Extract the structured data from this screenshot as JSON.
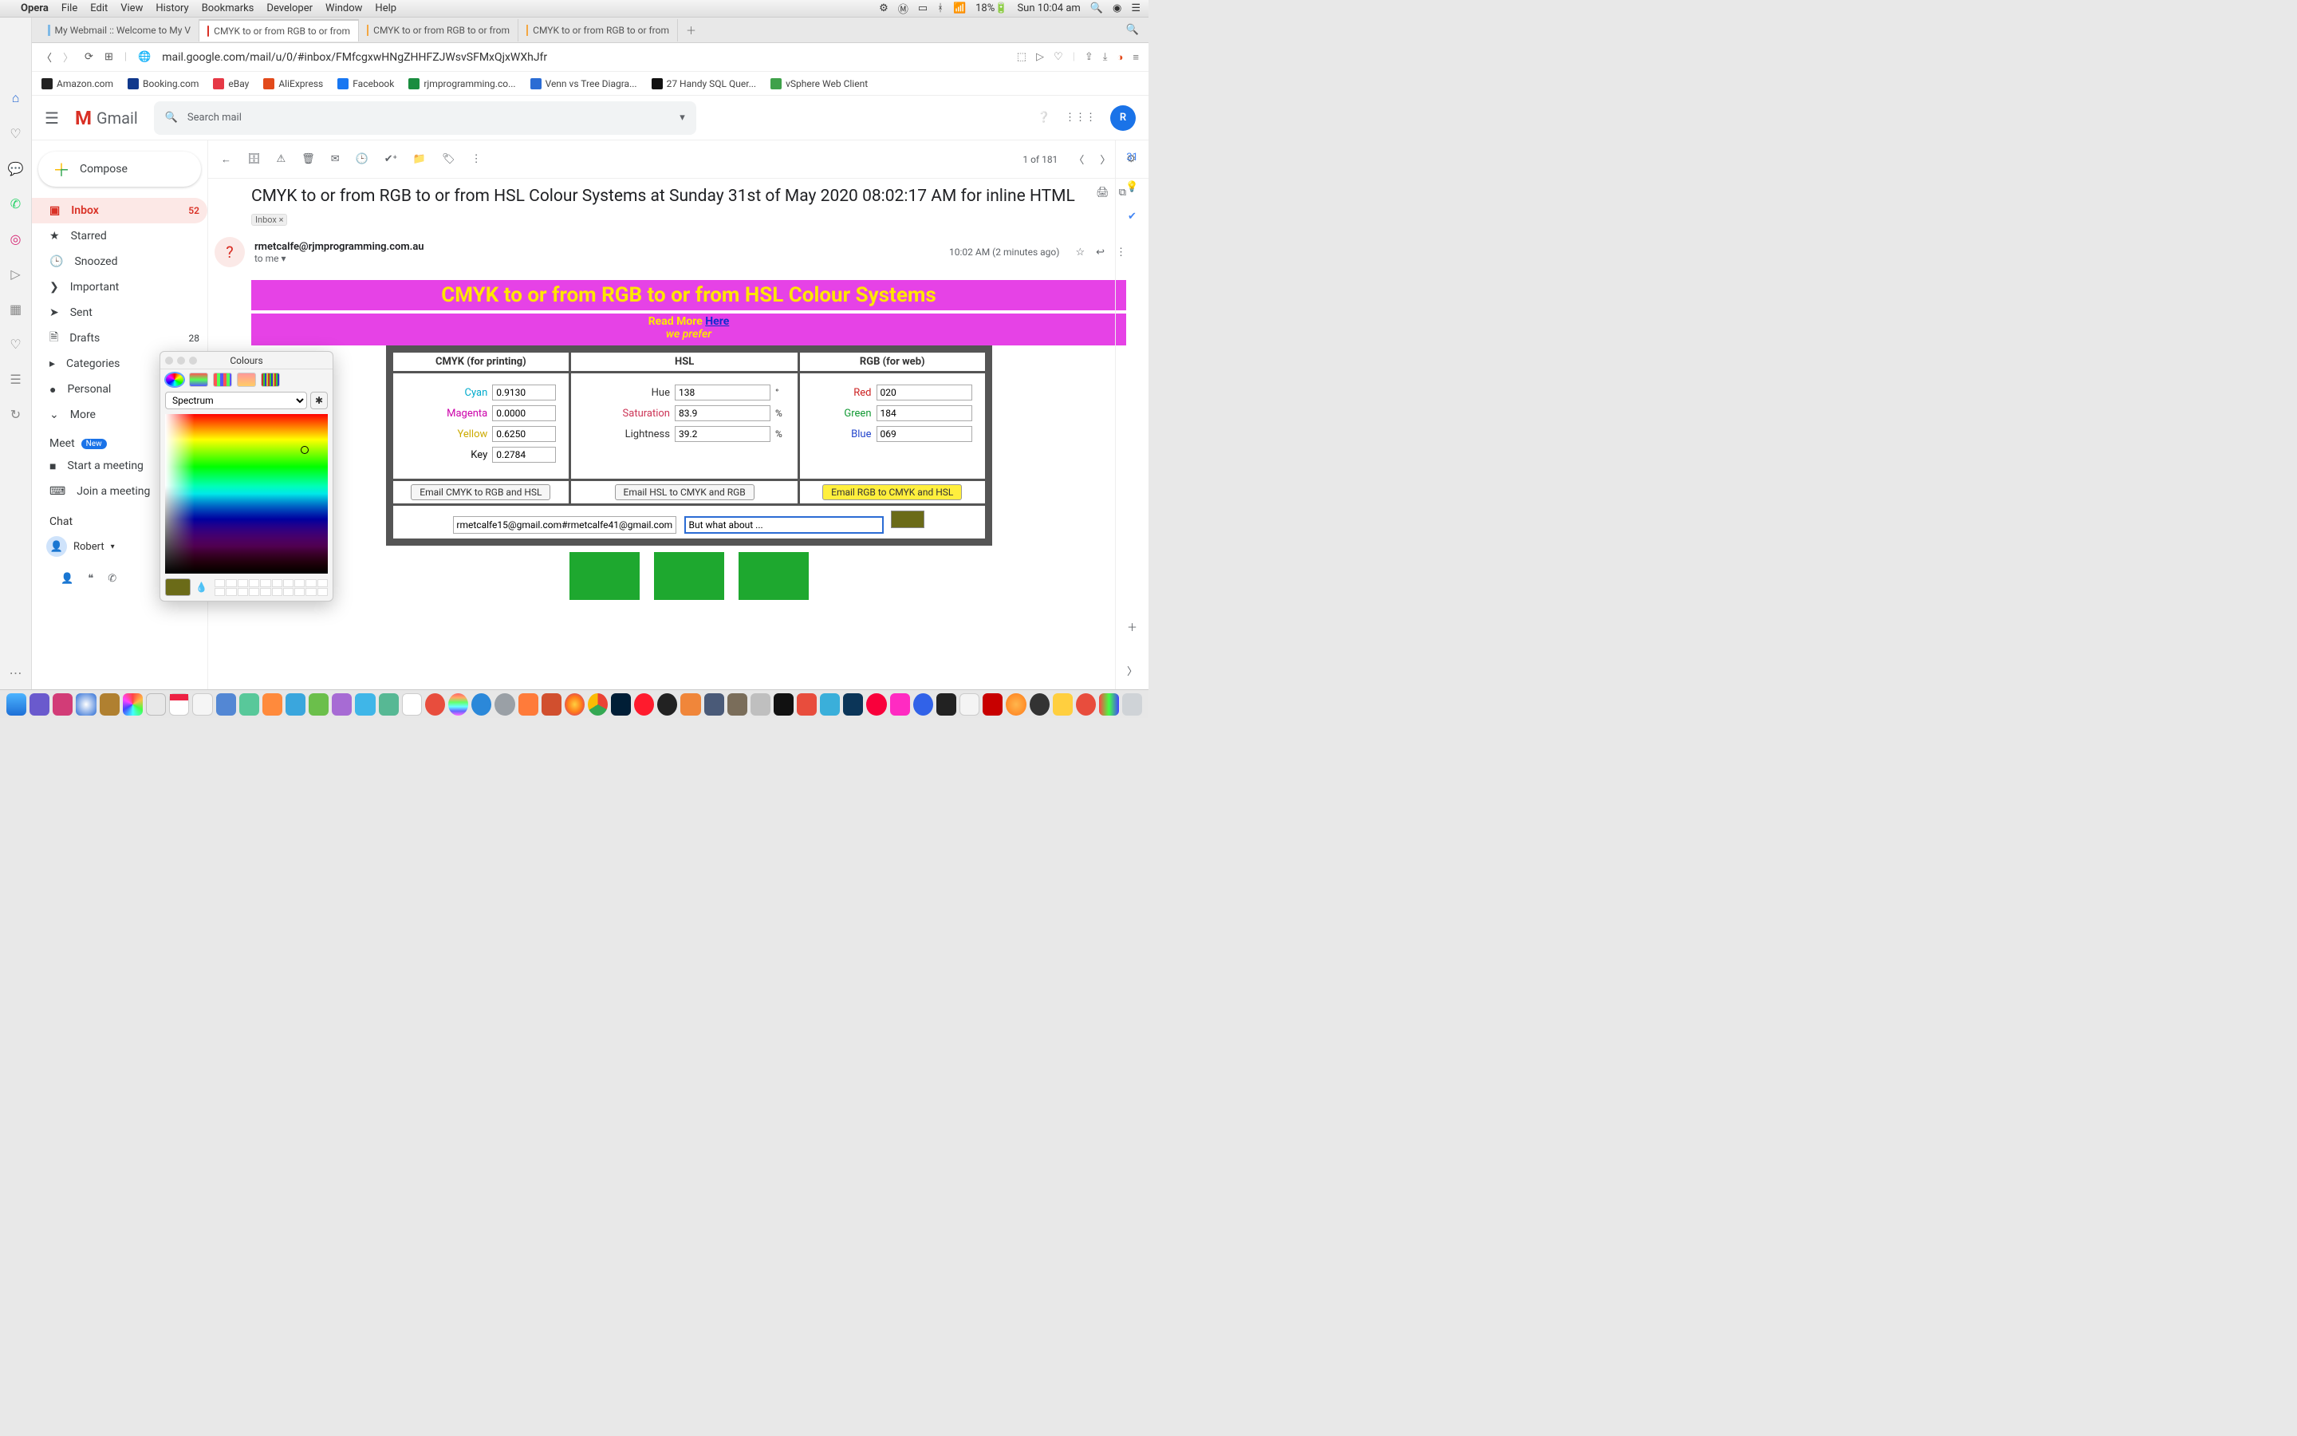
{
  "menubar": {
    "app": "Opera",
    "items": [
      "File",
      "Edit",
      "View",
      "History",
      "Bookmarks",
      "Developer",
      "Window",
      "Help"
    ],
    "battery": "18%",
    "clock": "Sun 10:04 am"
  },
  "tabs": [
    {
      "title": "My Webmail :: Welcome to My V",
      "icon": "#7fb9e6"
    },
    {
      "title": "CMYK to or from RGB to or from",
      "icon": "#d93025",
      "active": true
    },
    {
      "title": "CMYK to or from RGB to or from",
      "icon": "#f4a742"
    },
    {
      "title": "CMYK to or from RGB to or from",
      "icon": "#f4a742"
    }
  ],
  "url": "mail.google.com/mail/u/0/#inbox/FMfcgxwHNgZHHFZJWsvSFMxQjxWXhJfr",
  "bookmarks": [
    {
      "label": "Amazon.com",
      "c": "#222"
    },
    {
      "label": "Booking.com",
      "c": "#10388c"
    },
    {
      "label": "eBay",
      "c": "#e63946"
    },
    {
      "label": "AliExpress",
      "c": "#e24a1b"
    },
    {
      "label": "Facebook",
      "c": "#1877f2"
    },
    {
      "label": "rjmprogramming.co...",
      "c": "#1a8d3f"
    },
    {
      "label": "Venn vs Tree Diagra...",
      "c": "#2b6cd4"
    },
    {
      "label": "27 Handy SQL Quer...",
      "c": "#111"
    },
    {
      "label": "vSphere Web Client",
      "c": "#3fa14a"
    }
  ],
  "gmail": {
    "brand": "Gmail",
    "search_placeholder": "Search mail",
    "compose": "Compose",
    "avatar": "R",
    "nav": [
      {
        "label": "Inbox",
        "count": "52",
        "active": true,
        "icon": "📥"
      },
      {
        "label": "Starred",
        "icon": "★"
      },
      {
        "label": "Snoozed",
        "icon": "🕒"
      },
      {
        "label": "Important",
        "icon": "❯"
      },
      {
        "label": "Sent",
        "icon": "➤"
      },
      {
        "label": "Drafts",
        "count": "28",
        "icon": "📄"
      },
      {
        "label": "Categories",
        "icon": "▸"
      },
      {
        "label": "Personal",
        "icon": "●"
      },
      {
        "label": "More",
        "icon": "⌄"
      }
    ],
    "meet": {
      "heading": "Meet",
      "new": "New",
      "start": "Start a meeting",
      "join": "Join a meeting"
    },
    "chat": {
      "heading": "Chat",
      "name": "Robert"
    },
    "toolbar_count": "1 of 181"
  },
  "message": {
    "subject": "CMYK to or from RGB to or from HSL Colour Systems at Sunday 31st of May 2020 08:02:17 AM for inline HTML",
    "chip": "Inbox ×",
    "from": "rmetcalfe@rjmprogramming.com.au",
    "to": "to me ▾",
    "time": "10:02 AM (2 minutes ago)"
  },
  "email": {
    "title": "CMYK to or from RGB to or from HSL Colour Systems",
    "readmore": "Read More ",
    "here": "Here",
    "weprefer": "we prefer",
    "th": [
      "CMYK (for printing)",
      "HSL",
      "RGB (for web)"
    ],
    "cmyk": {
      "c": "0.9130",
      "m": "0.0000",
      "y": "0.6250",
      "k": "0.2784",
      "lc": "Cyan",
      "lm": "Magenta",
      "ly": "Yellow",
      "lk": "Key"
    },
    "hsl": {
      "h": "138",
      "s": "83.9",
      "l": "39.2",
      "lh": "Hue",
      "ls": "Saturation",
      "ll": "Lightness",
      "deg": "°",
      "pct": "%"
    },
    "rgb": {
      "r": "020",
      "g": "184",
      "b": "069",
      "lr": "Red",
      "lg": "Green",
      "lb": "Blue"
    },
    "btns": [
      "Email CMYK to RGB and HSL",
      "Email HSL to CMYK and RGB",
      "Email RGB to CMYK and HSL"
    ],
    "footer_email": "rmetcalfe15@gmail.com#rmetcalfe41@gmail.com",
    "footer_msg": "But what about ..."
  },
  "colours": {
    "title": "Colours",
    "mode": "Spectrum"
  }
}
